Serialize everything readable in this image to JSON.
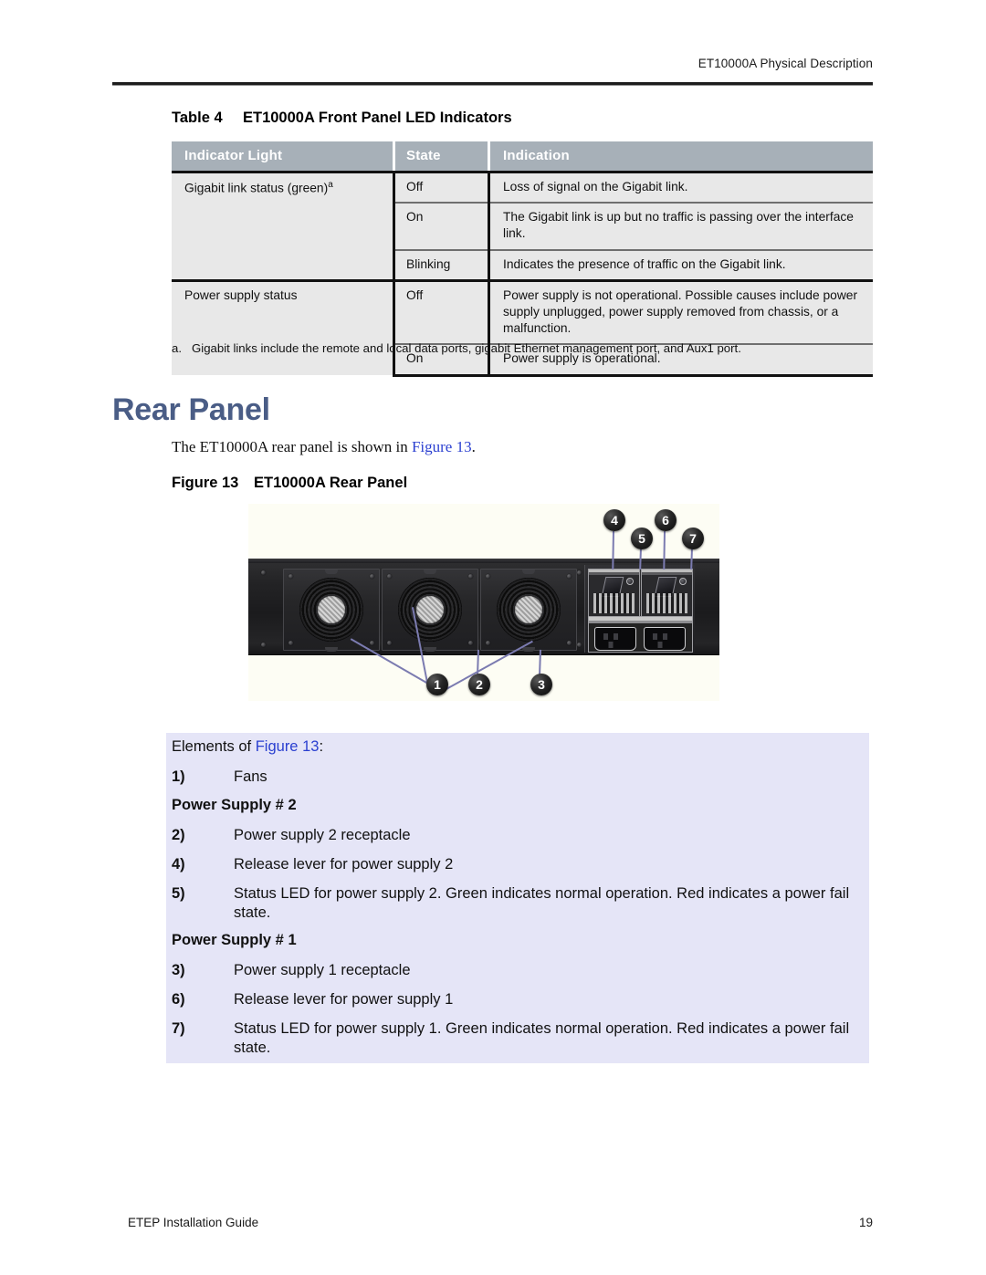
{
  "page": {
    "running_header": "ET10000A Physical Description",
    "footer_left": "ETEP Installation Guide",
    "footer_page_number": "19"
  },
  "table": {
    "caption_number": "Table 4",
    "caption_title": "ET10000A Front Panel LED Indicators",
    "headers": [
      "Indicator Light",
      "State",
      "Indication"
    ],
    "rows": [
      {
        "light": "Gigabit link status (green)",
        "light_footnote": "a",
        "state": "Off",
        "indication": "Loss of signal on the Gigabit link."
      },
      {
        "light": "",
        "state": "On",
        "indication": "The Gigabit link is up but no traffic is passing over the interface link."
      },
      {
        "light": "",
        "state": "Blinking",
        "indication": "Indicates the presence of traffic on the Gigabit link."
      },
      {
        "light": "Power supply status",
        "state": "Off",
        "indication": "Power supply is not operational. Possible causes include power supply unplugged, power supply removed from chassis, or a malfunction."
      },
      {
        "light": "",
        "state": "On",
        "indication": "Power supply is operational."
      }
    ],
    "footnote_marker": "a.",
    "footnote_text": "Gigabit links include the remote and local data ports, gigabit Ethernet management port, and Aux1 port."
  },
  "section": {
    "heading": "Rear Panel",
    "paragraph_before_link": "The ET10000A rear panel is shown in ",
    "paragraph_link": "Figure 13",
    "paragraph_after_link": "."
  },
  "figure": {
    "caption_number": "Figure 13",
    "caption_title": "ET10000A Rear Panel",
    "callouts": [
      "1",
      "2",
      "3",
      "4",
      "5",
      "6",
      "7"
    ]
  },
  "elements": {
    "intro_before_link": "Elements of ",
    "intro_link": "Figure 13",
    "intro_after_link": ":",
    "item1_num": "1)",
    "item1_text": "Fans",
    "ps2_heading": "Power Supply # 2",
    "item2_num": "2)",
    "item2_text": "Power supply 2 receptacle",
    "item4_num": "4)",
    "item4_text": "Release lever for power supply 2",
    "item5_num": "5)",
    "item5_text": "Status LED for power supply 2. Green indicates normal operation. Red indicates a power fail state.",
    "ps1_heading": "Power Supply # 1",
    "item3_num": "3)",
    "item3_text": "Power supply 1 receptacle",
    "item6_num": "6)",
    "item6_text": "Release lever for power supply 1",
    "item7_num": "7)",
    "item7_text": "Status LED for power supply 1. Green indicates normal operation. Red indicates a power fail state."
  },
  "colors": {
    "heading_blue": "#4a5d86",
    "link_blue": "#2a3fd0",
    "table_header_gray": "#a7b0b8",
    "table_cell_gray": "#e8e8e8",
    "elements_box_lavender": "#e5e5f7",
    "callout_dark": "#1a1a1a",
    "leader_purple": "#7b7bb0"
  }
}
